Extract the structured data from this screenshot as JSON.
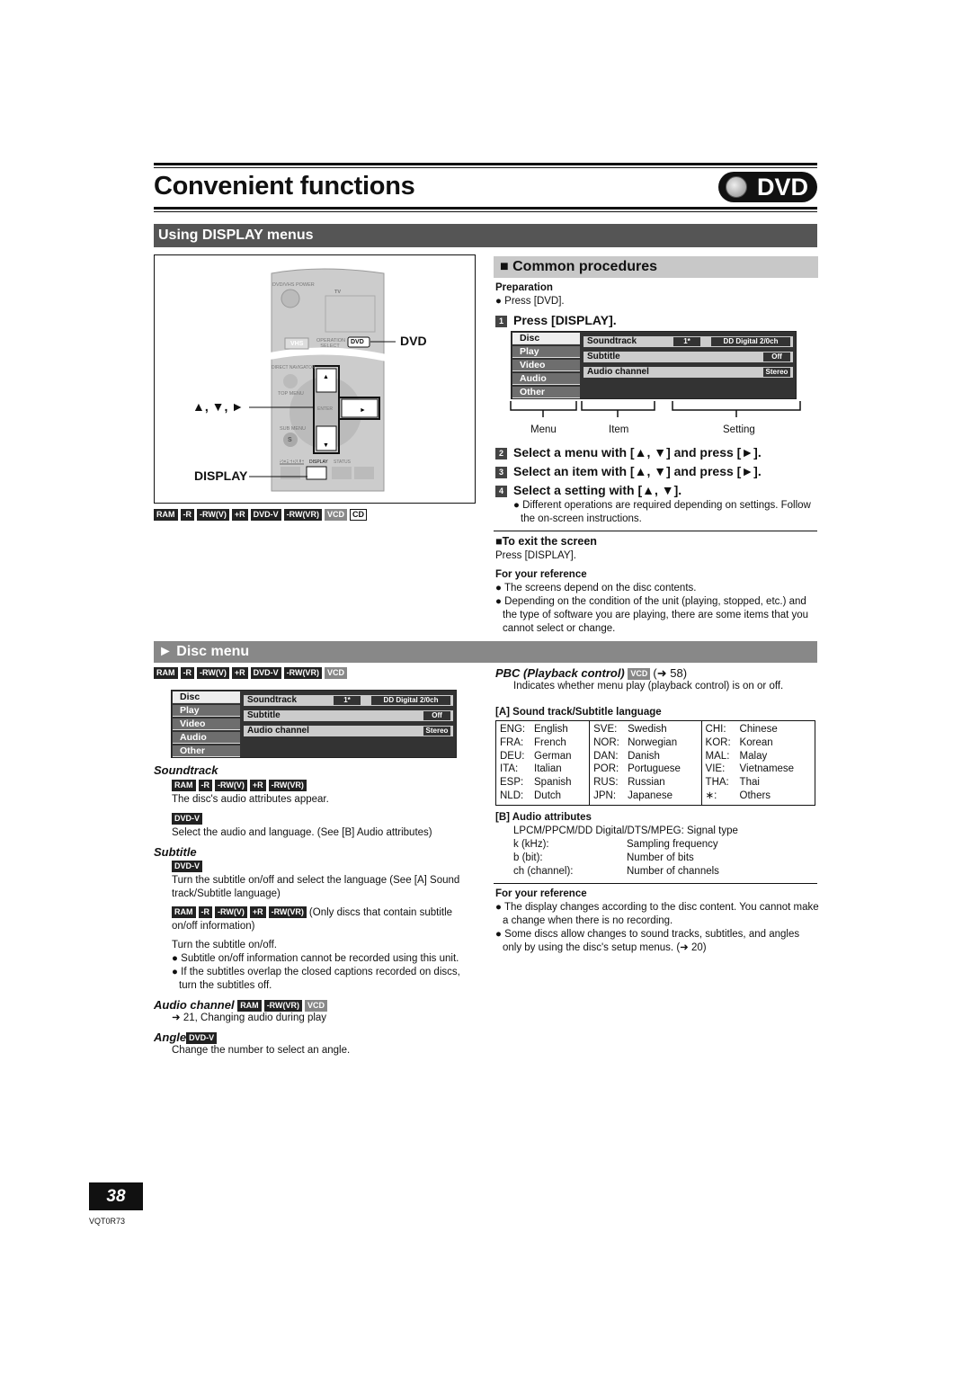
{
  "header": {
    "title": "Convenient functions",
    "logo": "DVD"
  },
  "section1": {
    "title": "Using DISPLAY menus"
  },
  "remote": {
    "dvd_label": "DVD",
    "arrows_label": "▲, ▼, ►",
    "display_label": "DISPLAY",
    "buttons": {
      "power": "DVD/VHS POWER",
      "tv": "TV",
      "vhs": "VHS",
      "op": "OPERATION SELECT",
      "dvd": "DVD",
      "enter": "ENTER",
      "direct": "DIRECT NAVIGATOR",
      "top": "TOP MENU",
      "sub": "SUB MENU",
      "s": "S",
      "schedule": "SCHEDULE",
      "display": "DISPLAY",
      "status": "STATUS"
    }
  },
  "badges_top": [
    "RAM",
    "-R",
    "-RW(V)",
    "+R",
    "DVD-V",
    "-RW(VR)",
    "VCD",
    "CD"
  ],
  "common": {
    "title": "Common procedures",
    "prep_h": "Preparation",
    "prep": "Press [DVD].",
    "step1": "Press [DISPLAY].",
    "labels": {
      "menu": "Menu",
      "item": "Item",
      "setting": "Setting"
    },
    "step2": "Select a menu with [▲, ▼] and press [►].",
    "step3": "Select an item with [▲, ▼] and press [►].",
    "step4": "Select a setting with [▲, ▼].",
    "step4_note": "Different operations are required depending on settings. Follow the on-screen instructions.",
    "exit_h": "To exit the screen",
    "exit": "Press [DISPLAY].",
    "ref_h": "For your reference",
    "ref": [
      "The screens depend on the disc contents.",
      "Depending on the condition of the unit (playing, stopped, etc.) and the type of software you are playing, there are some items that you cannot select or change."
    ]
  },
  "screen": {
    "menus": [
      "Disc",
      "Play",
      "Video",
      "Audio",
      "Other"
    ],
    "items": [
      "Soundtrack",
      "Subtitle",
      "Audio channel"
    ],
    "soundtrack_num": "1*",
    "soundtrack_val": "DD Digital  2/0ch",
    "subtitle_val": "Off",
    "audio_val": "Stereo"
  },
  "disc": {
    "title": "Disc menu",
    "badges": [
      "RAM",
      "-R",
      "-RW(V)",
      "+R",
      "DVD-V",
      "-RW(VR)",
      "VCD"
    ],
    "soundtrack_h": "Soundtrack",
    "soundtrack_badges": [
      "RAM",
      "-R",
      "-RW(V)",
      "+R",
      "-RW(VR)"
    ],
    "soundtrack_t1": "The disc's audio attributes appear.",
    "soundtrack_b2": "DVD-V",
    "soundtrack_t2": "Select the audio and language. (See [B] Audio attributes)",
    "subtitle_h": "Subtitle",
    "subtitle_b1": "DVD-V",
    "subtitle_t1": "Turn the subtitle on/off and select the language (See [A] Sound track/Subtitle language)",
    "subtitle_badges": [
      "RAM",
      "-R",
      "-RW(V)",
      "+R",
      "-RW(VR)"
    ],
    "subtitle_t2": "(Only discs that contain subtitle on/off information)",
    "subtitle_t3": "Turn the subtitle on/off.",
    "subtitle_bul": [
      "Subtitle on/off information cannot be recorded using this unit.",
      "If the subtitles overlap the closed captions recorded on discs, turn the subtitles off."
    ],
    "audio_h": "Audio channel",
    "audio_badges": [
      "RAM",
      "-RW(VR)",
      "VCD"
    ],
    "audio_t": "➜ 21, Changing audio during play",
    "angle_h": "Angle",
    "angle_badge": "DVD-V",
    "angle_t": "Change the number to select an angle.",
    "pbc_h": "PBC (Playback control)",
    "pbc_badge": "VCD",
    "pbc_ref": "(➜ 58)",
    "pbc_t": "Indicates whether menu play (playback control) is on or off.",
    "lang_h": "[A] Sound track/Subtitle language",
    "lang": [
      [
        [
          "ENG:",
          "English"
        ],
        [
          "FRA:",
          "French"
        ],
        [
          "DEU:",
          "German"
        ],
        [
          "ITA:",
          "Italian"
        ],
        [
          "ESP:",
          "Spanish"
        ],
        [
          "NLD:",
          "Dutch"
        ]
      ],
      [
        [
          "SVE:",
          "Swedish"
        ],
        [
          "NOR:",
          "Norwegian"
        ],
        [
          "DAN:",
          "Danish"
        ],
        [
          "POR:",
          "Portuguese"
        ],
        [
          "RUS:",
          "Russian"
        ],
        [
          "JPN:",
          "Japanese"
        ]
      ],
      [
        [
          "CHI:",
          "Chinese"
        ],
        [
          "KOR:",
          "Korean"
        ],
        [
          "MAL:",
          "Malay"
        ],
        [
          "VIE:",
          "Vietnamese"
        ],
        [
          "THA:",
          "Thai"
        ],
        [
          "∗:",
          "Others"
        ]
      ]
    ],
    "attr_h": "[B] Audio attributes",
    "attr": [
      [
        "LPCM/PPCM/DD Digital/DTS/MPEG: Signal type",
        ""
      ],
      [
        "k (kHz):",
        "Sampling frequency"
      ],
      [
        "b (bit):",
        "Number of bits"
      ],
      [
        "ch (channel):",
        "Number of channels"
      ]
    ],
    "ref_h": "For your reference",
    "ref": [
      "The display changes according to the disc content. You cannot make a change when there is no recording.",
      "Some discs allow changes to sound tracks, subtitles, and angles only by using the disc's setup menus. (➜ 20)"
    ]
  },
  "footer": {
    "page": "38",
    "code": "VQT0R73"
  }
}
